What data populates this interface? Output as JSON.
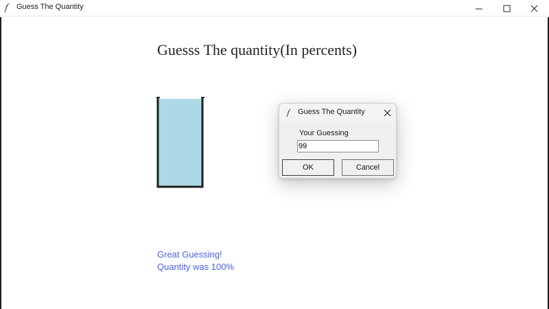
{
  "window": {
    "title": "Guess The Quantity",
    "minimize_glyph": "—",
    "maximize_glyph": "☐",
    "close_glyph": "✕"
  },
  "main": {
    "heading": "Guesss The quantity(In percents)",
    "glass": {
      "fill_fraction": 1.0,
      "liquid_color": "#add8e6"
    },
    "result_line1": "Great Guessing!",
    "result_line2": "Quantity was 100%",
    "result_color": "#4a5ee8"
  },
  "dialog": {
    "title": "Guess The Quantity",
    "close_glyph": "✕",
    "label": "Your Guessing",
    "input_value": "99",
    "ok_label": "OK",
    "cancel_label": "Cancel"
  },
  "icons": {
    "app": "feather-icon",
    "dialog": "feather-icon"
  }
}
